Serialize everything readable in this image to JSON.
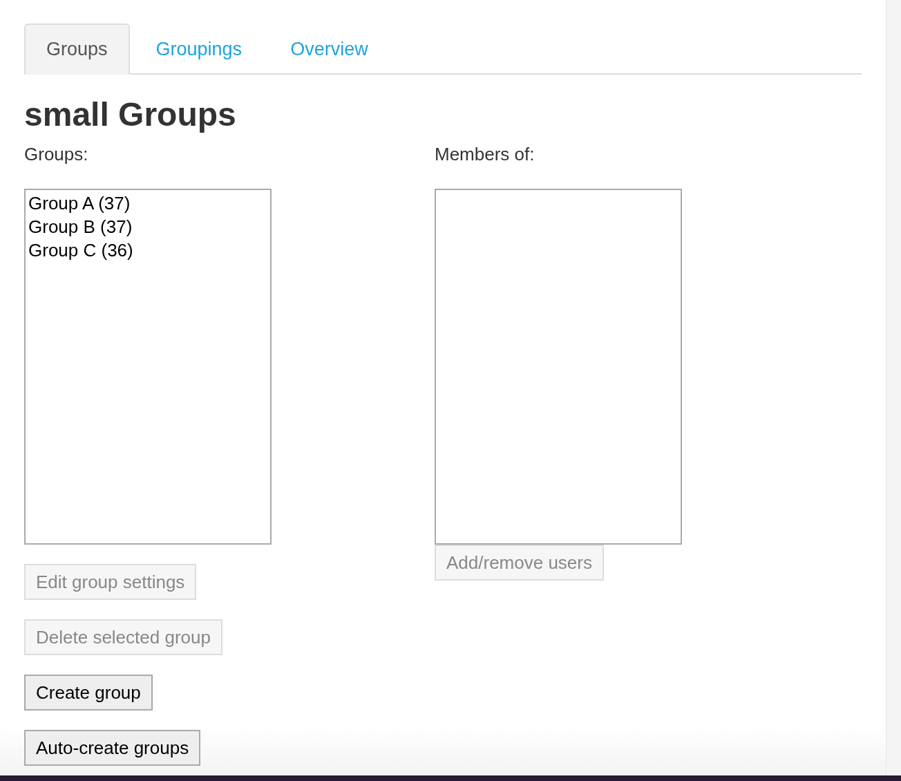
{
  "tabs": [
    {
      "label": "Groups",
      "selected": true
    },
    {
      "label": "Groupings",
      "selected": false
    },
    {
      "label": "Overview",
      "selected": false
    }
  ],
  "heading": "small Groups",
  "groups_panel": {
    "label": "Groups:",
    "options": [
      {
        "text": "Group A (37)",
        "selected": false
      },
      {
        "text": "Group B (37)",
        "selected": false
      },
      {
        "text": "Group C (36)",
        "selected": false
      }
    ],
    "buttons": [
      {
        "label": "Edit group settings",
        "disabled": true
      },
      {
        "label": "Delete selected group",
        "disabled": true
      },
      {
        "label": "Create group",
        "disabled": false
      },
      {
        "label": "Auto-create groups",
        "disabled": false
      }
    ]
  },
  "members_panel": {
    "label": "Members of:",
    "buttons": [
      {
        "label": "Add/remove users",
        "disabled": true
      }
    ]
  }
}
